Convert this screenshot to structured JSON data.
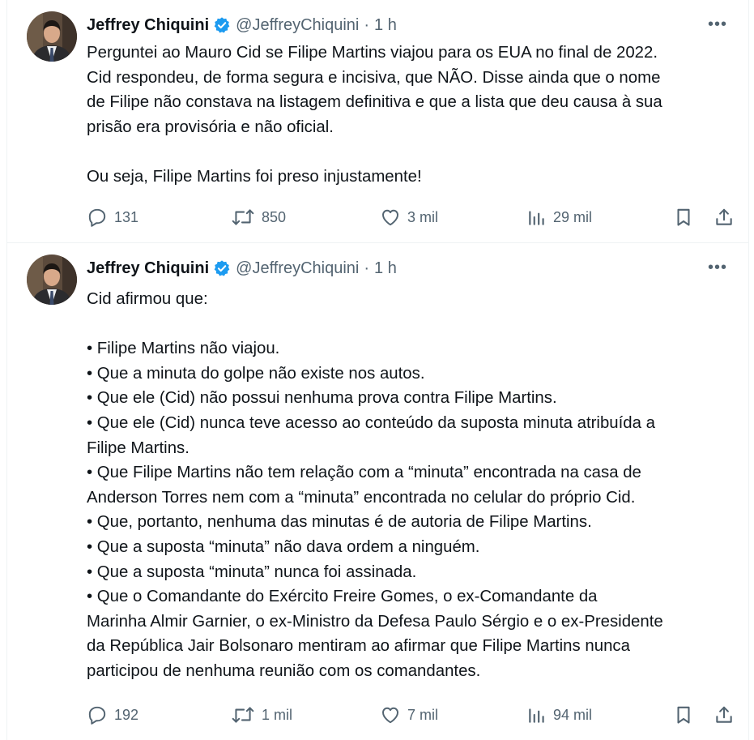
{
  "tweets": [
    {
      "author": {
        "name": "Jeffrey Chiquini",
        "handle": "@JeffreyChiquini",
        "verified": true,
        "avatar_icon": "profile-photo"
      },
      "separator": "·",
      "time": "1 h",
      "more_icon": "more-horizontal-icon",
      "more_label": "•••",
      "lines": [
        "Perguntei ao Mauro Cid se Filipe Martins viajou para os EUA no final de 2022.",
        "Cid respondeu, de forma segura e incisiva, que NÃO. Disse ainda que o nome",
        "de Filipe não constava na listagem definitiva e que a lista que deu causa à sua",
        "prisão era provisória e não oficial.",
        "",
        "Ou seja, Filipe Martins foi preso injustamente!"
      ],
      "metrics": {
        "replies": "131",
        "retweets": "850",
        "likes": "3 mil",
        "views": "29 mil"
      }
    },
    {
      "author": {
        "name": "Jeffrey Chiquini",
        "handle": "@JeffreyChiquini",
        "verified": true,
        "avatar_icon": "profile-photo"
      },
      "separator": "·",
      "time": "1 h",
      "more_icon": "more-horizontal-icon",
      "more_label": "•••",
      "lines": [
        "Cid afirmou que:",
        "",
        "• Filipe Martins não viajou.",
        "• Que a minuta do golpe não existe nos autos.",
        "• Que ele (Cid) não possui nenhuma prova contra Filipe Martins.",
        "• Que ele (Cid) nunca teve acesso ao conteúdo da suposta minuta atribuída a",
        "Filipe Martins.",
        "• Que Filipe Martins não tem relação com a “minuta” encontrada na casa de",
        "Anderson Torres nem com a “minuta” encontrada no celular do próprio Cid.",
        "• Que, portanto, nenhuma das minutas é de autoria de Filipe Martins.",
        "• Que a suposta “minuta” não dava ordem a ninguém.",
        "• Que a suposta “minuta” nunca foi assinada.",
        "• Que o Comandante do Exército Freire Gomes, o ex-Comandante da",
        "Marinha Almir Garnier, o ex-Ministro da Defesa Paulo Sérgio e o ex-Presidente",
        "da República Jair Bolsonaro mentiram ao afirmar que Filipe Martins nunca",
        "participou de nenhuma reunião com os comandantes."
      ],
      "metrics": {
        "replies": "192",
        "retweets": "1 mil",
        "likes": "7 mil",
        "views": "94 mil"
      }
    }
  ],
  "icons": {
    "reply": "reply-icon",
    "retweet": "retweet-icon",
    "like": "heart-icon",
    "views": "views-chart-icon",
    "bookmark": "bookmark-icon",
    "share": "share-icon",
    "verified": "verified-badge-icon"
  },
  "colors": {
    "text": "#0f1419",
    "secondary": "#536471",
    "verified": "#1d9bf0",
    "divider": "#eff3f4"
  }
}
